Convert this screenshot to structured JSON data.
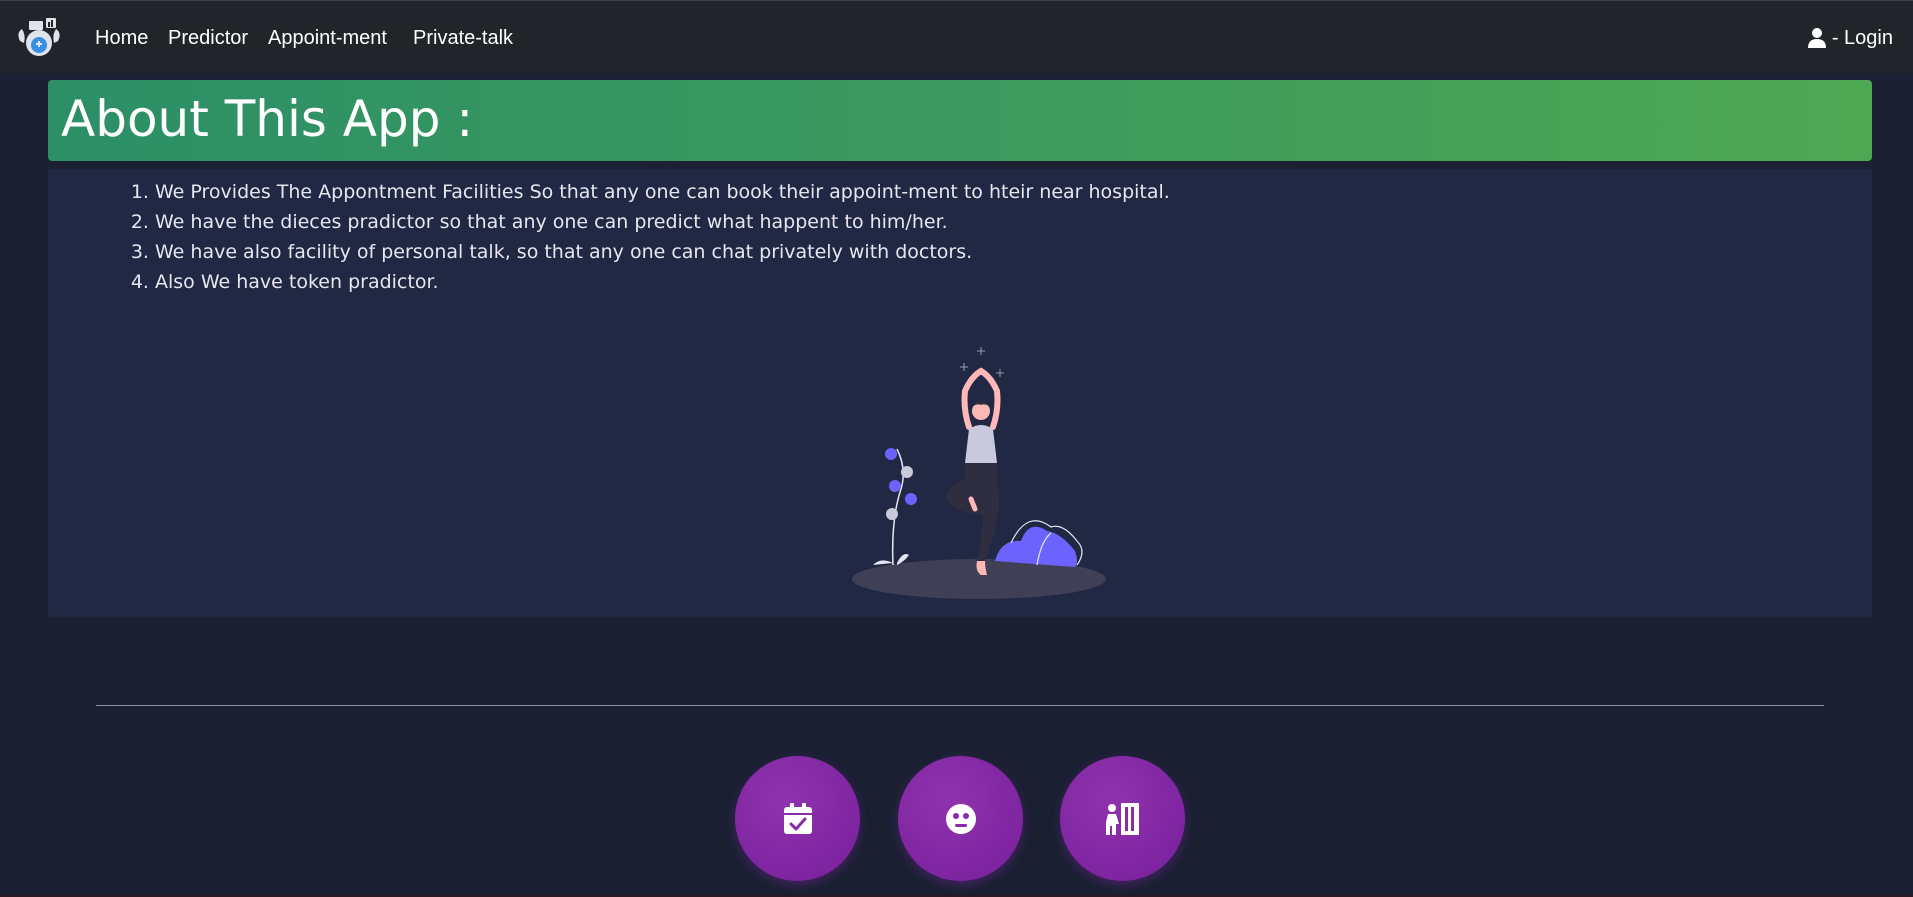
{
  "navbar": {
    "logo_icon": "doctor-robot-logo",
    "links": [
      "Home",
      "Predictor",
      "Appoint-ment",
      "Private-talk"
    ],
    "login_icon": "user-icon",
    "login_label": "- Login"
  },
  "header": {
    "title": "About This App :"
  },
  "features": [
    "We Provides The Appontment Facilities So that any one can book their appoint-ment to hteir near hospital.",
    "We have the dieces pradictor so that any one can predict what happent to him/her.",
    "We have also facility of personal talk, so that any one can chat privately with doctors.",
    "Also We have token pradictor."
  ],
  "illustration": "yoga-woman-illustration",
  "action_buttons": [
    {
      "icon": "calendar-check-icon"
    },
    {
      "icon": "face-icon"
    },
    {
      "icon": "person-token-icon"
    }
  ],
  "colors": {
    "navbar_bg": "#212429",
    "page_bg": "#1b2033",
    "panel_bg": "#212844",
    "banner_start": "#2c8f66",
    "banner_end": "#4ea853",
    "button_purple": "#8a2bab"
  }
}
